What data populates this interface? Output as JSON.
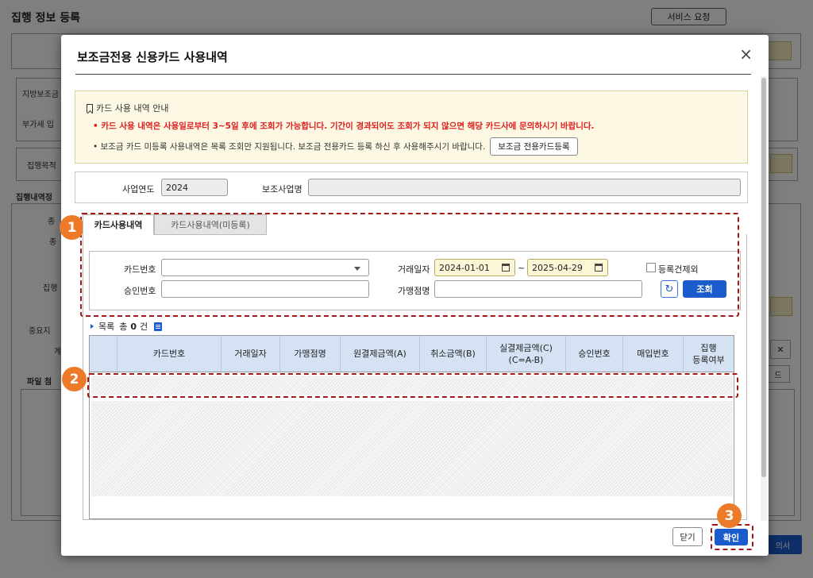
{
  "background": {
    "title": "집행 정보 등록",
    "service_request": "서비스 요청",
    "labels": [
      "지방보조금",
      "부가세 입",
      "집행목적",
      "집행내역정",
      "종",
      "종",
      "집행",
      "중요지",
      "계",
      "파일 첨"
    ],
    "right_btn": "드",
    "bottom_btn": "의서",
    "close_x": "✕"
  },
  "modal": {
    "title": "보조금전용 신용카드 사용내역",
    "close_icon": "×",
    "notice": {
      "heading": "카드 사용 내역 안내",
      "line1": "• 카드 사용 내역은 사용일로부터 3~5일 후에 조회가 가능합니다. 기간이 경과되어도 조회가 되지 않으면 해당 카드사에 문의하시기 바랍니다.",
      "line2": "• 보조금 카드 미등록 사용내역은 목록 조회만 지원됩니다. 보조금 전용카드 등록 하신 후 사용해주시기 바랍니다.",
      "register_button": "보조금 전용카드등록"
    },
    "year_label": "사업연도",
    "year_value": "2024",
    "project_label": "보조사업명",
    "project_value": "",
    "tabs": [
      {
        "label": "카드사용내역",
        "active": true
      },
      {
        "label": "카드사용내역(미등록)",
        "active": false
      }
    ],
    "search": {
      "card_no_label": "카드번호",
      "card_no_value": "",
      "trade_date_label": "거래일자",
      "date_from": "2024-01-01",
      "date_sep": "~",
      "date_to": "2025-04-29",
      "exclude_registered_label": "등록건제외",
      "approval_no_label": "승인번호",
      "approval_no_value": "",
      "merchant_label": "가맹점명",
      "merchant_value": "",
      "refresh_icon": "↻",
      "query_button": "조회"
    },
    "list": {
      "title": "목록",
      "total_prefix": "총",
      "count": "0",
      "unit": "건"
    },
    "table": {
      "columns": [
        "",
        "카드번호",
        "거래일자",
        "가맹점명",
        "원결제금액(A)",
        "취소금액(B)",
        "실결제금액(C)\n(C=A-B)",
        "승인번호",
        "매입번호",
        "집행\n등록여부"
      ]
    },
    "footer": {
      "close_button": "닫기",
      "confirm_button": "확인"
    }
  },
  "annotations": [
    "1",
    "2",
    "3"
  ],
  "colors": {
    "accent": "#1a5ccc",
    "annotation_circle": "#ec7a28",
    "annotation_border": "#a41717",
    "notice_red": "#e01c1c",
    "notice_bg": "#fdf8e3",
    "table_header": "#d4e2f3"
  }
}
